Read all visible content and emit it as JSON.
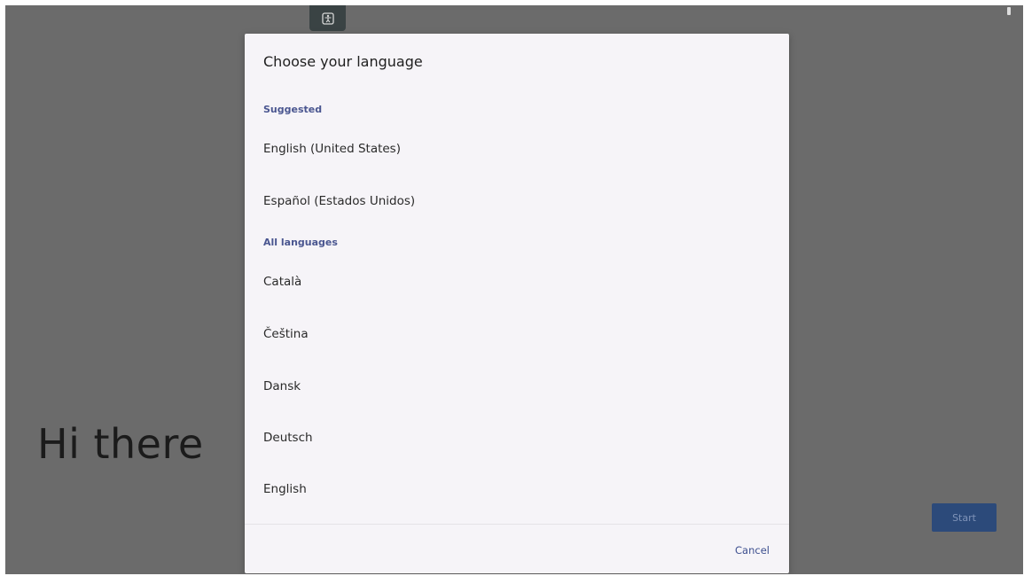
{
  "background": {
    "greeting": "Hi there",
    "start_label": "Start"
  },
  "icons": {
    "accessibility": "accessibility-icon",
    "status": "battery-icon"
  },
  "dialog": {
    "title": "Choose your language",
    "suggested_header": "Suggested",
    "suggested": [
      "English (United States)",
      "Español (Estados Unidos)"
    ],
    "all_header": "All languages",
    "all": [
      "Català",
      "Čeština",
      "Dansk",
      "Deutsch",
      "English"
    ],
    "cancel_label": "Cancel"
  },
  "colors": {
    "accent": "#4a5690",
    "start_button": "#2c4a7a",
    "overlay": "#6b6b6b"
  }
}
